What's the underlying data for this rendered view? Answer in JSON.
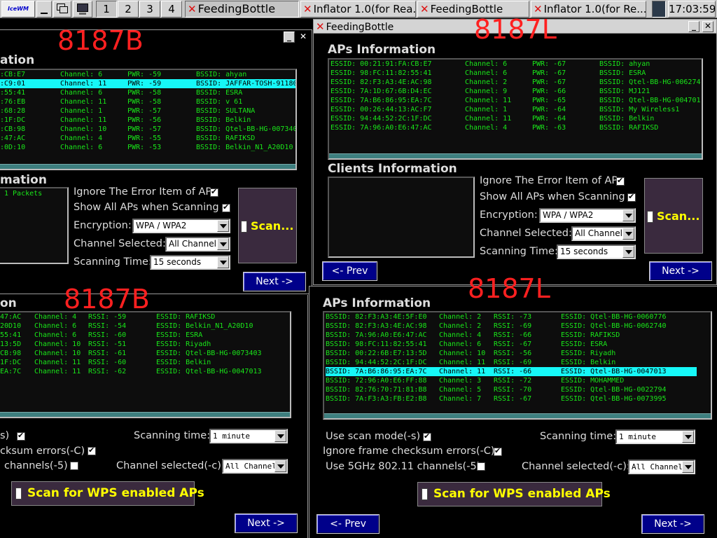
{
  "taskbar": {
    "logo": "IceWM",
    "desktops": [
      "1",
      "2",
      "3",
      "4"
    ],
    "active_desktop": "1",
    "tasks": [
      "FeedingBottle",
      "Inflator 1.0(for Rea...",
      "FeedingBottle",
      "Inflator 1.0(for Re..."
    ],
    "clock": "17:03:59"
  },
  "overlays": [
    "8187B",
    "8187L",
    "8187B",
    "8187L"
  ],
  "colors": {
    "list_text": "#19e619",
    "selected_row": "#16f7f7",
    "nav_button": "#00008a",
    "scan_text": "#ffff00",
    "overlay": "#ff2020"
  },
  "win_tl": {
    "aps_title": "ation",
    "aps": [
      {
        "essid": ":CB:E7",
        "ch": "Channel: 6",
        "pwr": "PWR: -59",
        "bssid": "BSSID: ahyan"
      },
      {
        "essid": ":C9:01",
        "ch": "Channel: 11",
        "pwr": "PWR: -59",
        "bssid": "BSSID: JAFFAR-TOSH-91180"
      },
      {
        "essid": ":55:41",
        "ch": "Channel: 6",
        "pwr": "PWR: -58",
        "bssid": "BSSID: ESRA"
      },
      {
        "essid": ":76:EB",
        "ch": "Channel: 11",
        "pwr": "PWR: -58",
        "bssid": "BSSID: v 61"
      },
      {
        "essid": ":68:28",
        "ch": "Channel: 1",
        "pwr": "PWR: -57",
        "bssid": "BSSID: SULTANA"
      },
      {
        "essid": ":1F:DC",
        "ch": "Channel: 11",
        "pwr": "PWR: -56",
        "bssid": "BSSID: Belkin"
      },
      {
        "essid": ":CB:98",
        "ch": "Channel: 10",
        "pwr": "PWR: -57",
        "bssid": "BSSID: Qtel-BB-HG-007340"
      },
      {
        "essid": ":47:AC",
        "ch": "Channel: 4",
        "pwr": "PWR: -55",
        "bssid": "BSSID: RAFIKSD"
      },
      {
        "essid": ":0D:10",
        "ch": "Channel: 6",
        "pwr": "PWR: -53",
        "bssid": "BSSID: Belkin_N1_A20D10"
      }
    ],
    "clients_title": "mation",
    "packets": "1 Packets",
    "ignore_label": "Ignore The Error Item of AP",
    "show_label": "Show All APs when Scanning",
    "encryption_label": "Encryption:",
    "encryption_value": "WPA / WPA2",
    "channel_label": "Channel Selected:",
    "channel_value": "All Channel",
    "time_label": "Scanning Time:",
    "time_value": "15 seconds",
    "scan_label": "Scan...",
    "next_label": "Next ->"
  },
  "win_tr": {
    "title": "FeedingBottle",
    "aps_title": "APs Information",
    "aps": [
      {
        "essid": "ESSID: 00:21:91:FA:CB:E7",
        "ch": "Channel: 6",
        "pwr": "PWR: -67",
        "bssid": "BSSID: ahyan"
      },
      {
        "essid": "ESSID: 98:FC:11:82:55:41",
        "ch": "Channel: 6",
        "pwr": "PWR: -67",
        "bssid": "BSSID: ESRA"
      },
      {
        "essid": "ESSID: 82:F3:A3:4E:AC:98",
        "ch": "Channel: 2",
        "pwr": "PWR: -67",
        "bssid": "BSSID: Qtel-BB-HG-006274"
      },
      {
        "essid": "ESSID: 7A:1D:67:6B:D4:EC",
        "ch": "Channel: 9",
        "pwr": "PWR: -66",
        "bssid": "BSSID: MJ121"
      },
      {
        "essid": "ESSID: 7A:B6:86:95:EA:7C",
        "ch": "Channel: 11",
        "pwr": "PWR: -65",
        "bssid": "BSSID: Qtel-BB-HG-004701"
      },
      {
        "essid": "ESSID: 00:26:44:13:AC:F7",
        "ch": "Channel: 1",
        "pwr": "PWR: -64",
        "bssid": "BSSID: My Wireless1"
      },
      {
        "essid": "ESSID: 94:44:52:2C:1F:DC",
        "ch": "Channel: 11",
        "pwr": "PWR: -64",
        "bssid": "BSSID: Belkin"
      },
      {
        "essid": "ESSID: 7A:96:A0:E6:47:AC",
        "ch": "Channel: 4",
        "pwr": "PWR: -63",
        "bssid": "BSSID: RAFIKSD"
      }
    ],
    "clients_title": "Clients Information",
    "ignore_label": "Ignore The Error Item of AP",
    "show_label": "Show All APs when Scanning",
    "encryption_label": "Encryption:",
    "encryption_value": "WPA / WPA2",
    "channel_label": "Channel Selected:",
    "channel_value": "All Channel",
    "time_label": "Scanning Time:",
    "time_value": "15 seconds",
    "scan_label": "Scan...",
    "prev_label": "<- Prev",
    "next_label": "Next ->"
  },
  "win_bl": {
    "aps_title": "on",
    "aps": [
      {
        "bssid": "47:AC",
        "ch": "Channel: 4",
        "rssi": "RSSI: -59",
        "essid": "ESSID: RAFIKSD"
      },
      {
        "bssid": "20D10",
        "ch": "Channel: 6",
        "rssi": "RSSI: -54",
        "essid": "ESSID: Belkin_N1_A20D10"
      },
      {
        "bssid": "55:41",
        "ch": "Channel: 6",
        "rssi": "RSSI: -60",
        "essid": "ESSID: ESRA"
      },
      {
        "bssid": "13:5D",
        "ch": "Channel: 10",
        "rssi": "RSSI: -51",
        "essid": "ESSID: Riyadh"
      },
      {
        "bssid": "CB:98",
        "ch": "Channel: 10",
        "rssi": "RSSI: -61",
        "essid": "ESSID: Qtel-BB-HG-0073403"
      },
      {
        "bssid": "1F:DC",
        "ch": "Channel: 11",
        "rssi": "RSSI: -60",
        "essid": "ESSID: Belkin"
      },
      {
        "bssid": "EA:7C",
        "ch": "Channel: 11",
        "rssi": "RSSI: -62",
        "essid": "ESSID: Qtel-BB-HG-0047013"
      }
    ],
    "scan_mode_label": "s)",
    "checksum_label": "cksum errors(-C)",
    "fiveg_label": "channels(-5)",
    "scan_time_label": "Scanning time:",
    "scan_time_value": "1 minute",
    "channel_label": "Channel selected(-c):",
    "channel_value": "All Channel",
    "wps_label": "Scan for WPS enabled APs",
    "next_label": "Next ->"
  },
  "win_br": {
    "aps_title": "APs Information",
    "aps": [
      {
        "bssid": "BSSID: 82:F3:A3:4E:5F:E0",
        "ch": "Channel: 2",
        "rssi": "RSSI: -73",
        "essid": "ESSID: Qtel-BB-HG-0060776"
      },
      {
        "bssid": "BSSID: 82:F3:A3:4E:AC:98",
        "ch": "Channel: 2",
        "rssi": "RSSI: -69",
        "essid": "ESSID: Qtel-BB-HG-0062740"
      },
      {
        "bssid": "BSSID: 7A:96:A0:E6:47:AC",
        "ch": "Channel: 4",
        "rssi": "RSSI: -66",
        "essid": "ESSID: RAFIKSD"
      },
      {
        "bssid": "BSSID: 98:FC:11:82:55:41",
        "ch": "Channel: 6",
        "rssi": "RSSI: -67",
        "essid": "ESSID: ESRA"
      },
      {
        "bssid": "BSSID: 00:22:6B:E7:13:5D",
        "ch": "Channel: 10",
        "rssi": "RSSI: -56",
        "essid": "ESSID: Riyadh"
      },
      {
        "bssid": "BSSID: 94:44:52:2C:1F:DC",
        "ch": "Channel: 11",
        "rssi": "RSSI: -69",
        "essid": "ESSID: Belkin"
      },
      {
        "bssid": "BSSID: 7A:B6:86:95:EA:7C",
        "ch": "Channel: 11",
        "rssi": "RSSI: -66",
        "essid": "ESSID: Qtel-BB-HG-0047013"
      },
      {
        "bssid": "BSSID: 72:96:A0:E6:FF:88",
        "ch": "Channel: 3",
        "rssi": "RSSI: -72",
        "essid": "ESSID: MOHAMMED"
      },
      {
        "bssid": "BSSID: 82:76:70:71:81:B8",
        "ch": "Channel: 5",
        "rssi": "RSSI: -70",
        "essid": "ESSID: Qtel-BB-HG-0022794"
      },
      {
        "bssid": "BSSID: 7A:F3:A3:FB:E2:B8",
        "ch": "Channel: 7",
        "rssi": "RSSI: -67",
        "essid": "ESSID: Qtel-BB-HG-0073995"
      }
    ],
    "scan_mode_label": "Use scan mode(-s)",
    "checksum_label": "Ignore frame checksum errors(-C)",
    "fiveg_label": "Use 5GHz 802.11 channels(-5)",
    "scan_time_label": "Scanning time:",
    "scan_time_value": "1 minute",
    "channel_label": "Channel selected(-c):",
    "channel_value": "All Channel",
    "wps_label": "Scan for WPS enabled APs",
    "prev_label": "<- Prev",
    "next_label": "Next ->"
  }
}
